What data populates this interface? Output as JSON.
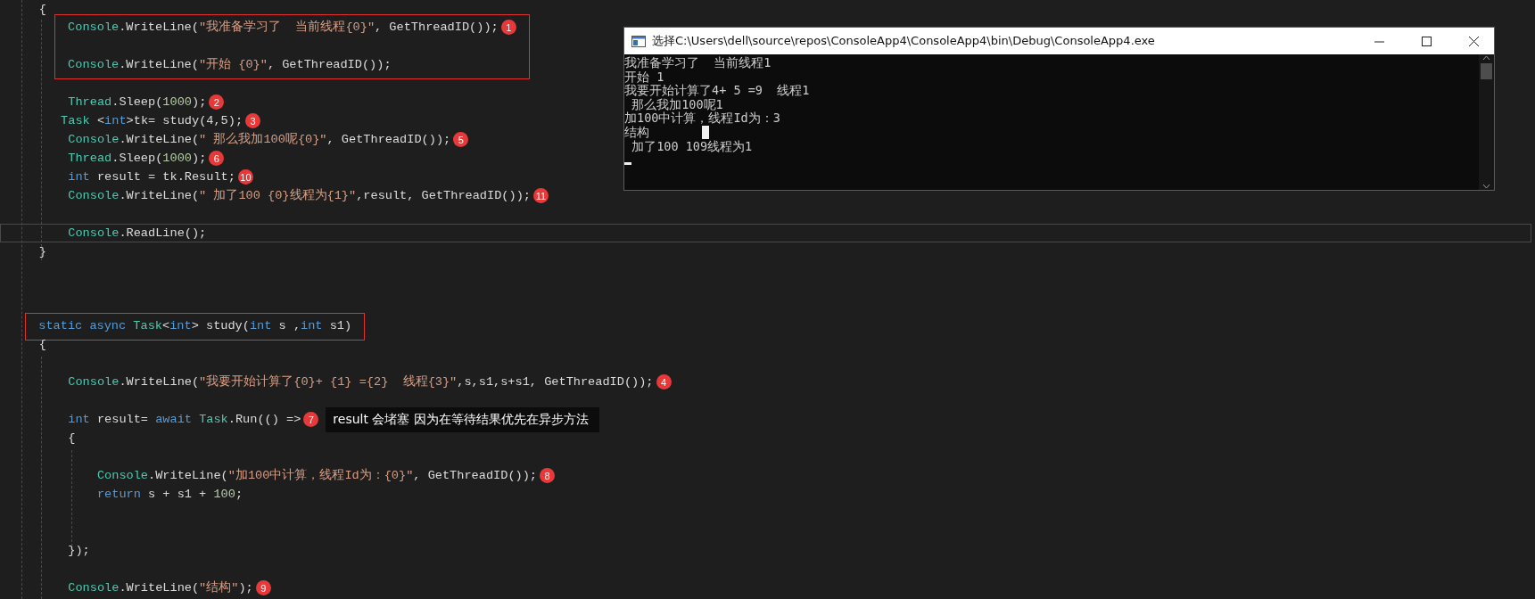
{
  "editor": {
    "blocks": [
      {
        "kind": "line",
        "current": false,
        "tokens": [
          {
            "kind": "plain",
            "text": "    {"
          }
        ]
      },
      {
        "kind": "boxed",
        "lines": [
          {
            "current": false,
            "marker": "1",
            "tokens": [
              {
                "kind": "type",
                "text": "        Console"
              },
              {
                "kind": "plain",
                "text": ".WriteLine("
              },
              {
                "kind": "string",
                "text": "\"我准备学习了  当前线程{0}\""
              },
              {
                "kind": "plain",
                "text": ", GetThreadID());"
              }
            ]
          },
          {
            "current": false
          },
          {
            "current": false,
            "tokens": [
              {
                "kind": "type",
                "text": "        Console"
              },
              {
                "kind": "plain",
                "text": ".WriteLine("
              },
              {
                "kind": "string",
                "text": "\"开始 {0}\""
              },
              {
                "kind": "plain",
                "text": ", GetThreadID());"
              }
            ]
          }
        ]
      },
      {
        "kind": "line",
        "current": false
      },
      {
        "kind": "line",
        "current": false,
        "marker": "2",
        "tokens": [
          {
            "kind": "type",
            "text": "        Thread"
          },
          {
            "kind": "plain",
            "text": ".Sleep("
          },
          {
            "kind": "number",
            "text": "1000"
          },
          {
            "kind": "plain",
            "text": ");"
          }
        ]
      },
      {
        "kind": "line",
        "current": false,
        "marker": "3",
        "tokens": [
          {
            "kind": "type",
            "text": "       Task"
          },
          {
            "kind": "plain",
            "text": " <"
          },
          {
            "kind": "keyword",
            "text": "int"
          },
          {
            "kind": "plain",
            "text": ">tk= study(4,5);"
          }
        ]
      },
      {
        "kind": "line",
        "current": false,
        "marker": "5",
        "tokens": [
          {
            "kind": "type",
            "text": "        Console"
          },
          {
            "kind": "plain",
            "text": ".WriteLine("
          },
          {
            "kind": "string",
            "text": "\" 那么我加100呢{0}\""
          },
          {
            "kind": "plain",
            "text": ", GetThreadID());"
          }
        ]
      },
      {
        "kind": "line",
        "current": false,
        "marker": "6",
        "tokens": [
          {
            "kind": "type",
            "text": "        Thread"
          },
          {
            "kind": "plain",
            "text": ".Sleep("
          },
          {
            "kind": "number",
            "text": "1000"
          },
          {
            "kind": "plain",
            "text": ");"
          }
        ]
      },
      {
        "kind": "line",
        "current": false,
        "marker": "10",
        "tokens": [
          {
            "kind": "keyword",
            "text": "        int"
          },
          {
            "kind": "plain",
            "text": " result = tk.Result;"
          }
        ]
      },
      {
        "kind": "line",
        "current": false,
        "marker": "11",
        "tokens": [
          {
            "kind": "type",
            "text": "        Console"
          },
          {
            "kind": "plain",
            "text": ".WriteLine("
          },
          {
            "kind": "string",
            "text": "\" 加了100 {0}线程为{1}\""
          },
          {
            "kind": "plain",
            "text": ",result, GetThreadID());"
          }
        ]
      },
      {
        "kind": "line",
        "current": false
      },
      {
        "kind": "line",
        "current": true,
        "tokens": [
          {
            "kind": "type",
            "text": "        Console"
          },
          {
            "kind": "plain",
            "text": ".ReadLine();"
          }
        ]
      },
      {
        "kind": "line",
        "current": false,
        "tokens": [
          {
            "kind": "plain",
            "text": "    }"
          }
        ]
      },
      {
        "kind": "line",
        "current": false
      },
      {
        "kind": "line",
        "current": false
      },
      {
        "kind": "line",
        "current": false
      },
      {
        "kind": "boxed",
        "lines": [
          {
            "current": false,
            "tokens": [
              {
                "kind": "keyword",
                "text": "    static async "
              },
              {
                "kind": "type",
                "text": "Task"
              },
              {
                "kind": "plain",
                "text": "<"
              },
              {
                "kind": "keyword",
                "text": "int"
              },
              {
                "kind": "plain",
                "text": "> study("
              },
              {
                "kind": "keyword",
                "text": "int"
              },
              {
                "kind": "plain",
                "text": " s ,"
              },
              {
                "kind": "keyword",
                "text": "int"
              },
              {
                "kind": "plain",
                "text": " s1)"
              }
            ]
          }
        ]
      },
      {
        "kind": "line",
        "current": false,
        "tokens": [
          {
            "kind": "plain",
            "text": "    {"
          }
        ]
      },
      {
        "kind": "line",
        "current": false
      },
      {
        "kind": "line",
        "current": false,
        "marker": "4",
        "tokens": [
          {
            "kind": "type",
            "text": "        Console"
          },
          {
            "kind": "plain",
            "text": ".WriteLine("
          },
          {
            "kind": "string",
            "text": "\"我要开始计算了{0}+ {1} ={2}  线程{3}\""
          },
          {
            "kind": "plain",
            "text": ",s,s1,s+s1, GetThreadID());"
          }
        ]
      },
      {
        "kind": "line",
        "current": false
      },
      {
        "kind": "line",
        "current": false,
        "marker": "7",
        "note": "result 会堵塞 因为在等待结果优先在异步方法",
        "tokens": [
          {
            "kind": "keyword",
            "text": "        int"
          },
          {
            "kind": "plain",
            "text": " result= "
          },
          {
            "kind": "keyword",
            "text": "await "
          },
          {
            "kind": "type",
            "text": "Task"
          },
          {
            "kind": "plain",
            "text": ".Run(() =>"
          }
        ]
      },
      {
        "kind": "line",
        "current": false,
        "tokens": [
          {
            "kind": "plain",
            "text": "        {"
          }
        ]
      },
      {
        "kind": "line",
        "current": false
      },
      {
        "kind": "line",
        "current": false,
        "marker": "8",
        "tokens": [
          {
            "kind": "type",
            "text": "            Console"
          },
          {
            "kind": "plain",
            "text": ".WriteLine("
          },
          {
            "kind": "string",
            "text": "\"加100中计算，线程Id为：{0}\""
          },
          {
            "kind": "plain",
            "text": ", GetThreadID());"
          }
        ]
      },
      {
        "kind": "line",
        "current": false,
        "tokens": [
          {
            "kind": "keyword",
            "text": "            return"
          },
          {
            "kind": "plain",
            "text": " s + s1 + "
          },
          {
            "kind": "number",
            "text": "100"
          },
          {
            "kind": "plain",
            "text": ";"
          }
        ]
      },
      {
        "kind": "line",
        "current": false
      },
      {
        "kind": "line",
        "current": false
      },
      {
        "kind": "line",
        "current": false,
        "tokens": [
          {
            "kind": "plain",
            "text": "        });"
          }
        ]
      },
      {
        "kind": "line",
        "current": false
      },
      {
        "kind": "line",
        "current": false,
        "marker": "9",
        "tokens": [
          {
            "kind": "type",
            "text": "        Console"
          },
          {
            "kind": "plain",
            "text": ".WriteLine("
          },
          {
            "kind": "string",
            "text": "\"结构\""
          },
          {
            "kind": "plain",
            "text": ");"
          }
        ]
      }
    ]
  },
  "console_window": {
    "title": "选择C:\\Users\\dell\\source\\repos\\ConsoleApp4\\ConsoleApp4\\bin\\Debug\\ConsoleApp4.exe",
    "lines": [
      "我准备学习了  当前线程1",
      "开始 1",
      "我要开始计算了4+ 5 =9  线程1",
      " 那么我加100呢1",
      "加100中计算，线程Id为：3",
      "结构",
      " 加了100 109线程为1"
    ]
  }
}
